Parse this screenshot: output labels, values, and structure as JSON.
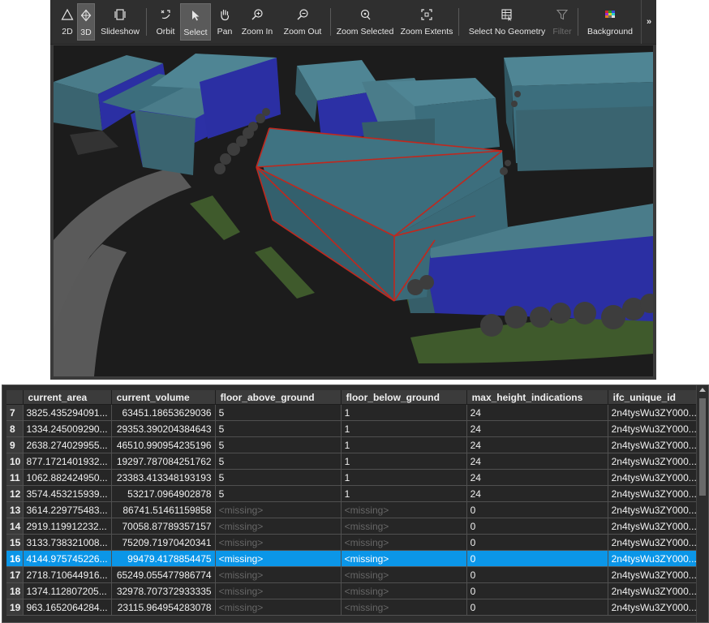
{
  "toolbar": {
    "items": [
      {
        "label": "2D",
        "icon": "triangle-icon"
      },
      {
        "label": "3D",
        "icon": "cube-3d-icon",
        "active": true
      },
      {
        "label": "Slideshow",
        "icon": "slideshow-icon"
      },
      {
        "label": "Orbit",
        "icon": "orbit-icon"
      },
      {
        "label": "Select",
        "icon": "cursor-icon",
        "active": true
      },
      {
        "label": "Pan",
        "icon": "hand-icon"
      },
      {
        "label": "Zoom In",
        "icon": "zoom-in-icon"
      },
      {
        "label": "Zoom Out",
        "icon": "zoom-out-icon"
      },
      {
        "label": "Zoom Selected",
        "icon": "zoom-selected-icon"
      },
      {
        "label": "Zoom Extents",
        "icon": "zoom-extents-icon"
      },
      {
        "label": "Select No Geometry",
        "icon": "select-no-geometry-icon"
      },
      {
        "label": "Filter",
        "icon": "filter-icon",
        "disabled": true
      },
      {
        "label": "Background",
        "icon": "background-palette-icon"
      }
    ],
    "overflow_label": "»"
  },
  "colors": {
    "selection_blue": "#0b96e8",
    "selection_outline": "#c0281e",
    "building_teal": "#3c6e7d",
    "building_blue": "#2b2fa3",
    "ground_green": "#3f5a2c"
  },
  "table": {
    "columns": [
      "current_area",
      "current_volume",
      "floor_above_ground",
      "floor_below_ground",
      "max_height_indications",
      "ifc_unique_id"
    ],
    "selected_row": 16,
    "rows": [
      {
        "idx": "7",
        "current_area": "3825.435294091...",
        "current_volume": "63451.18653629036",
        "floor_above_ground": "5",
        "floor_below_ground": "1",
        "max_height_indications": "24",
        "ifc_unique_id": "2n4tysWu3ZY000..."
      },
      {
        "idx": "8",
        "current_area": "1334.245009290...",
        "current_volume": "29353.390204384643",
        "floor_above_ground": "5",
        "floor_below_ground": "1",
        "max_height_indications": "24",
        "ifc_unique_id": "2n4tysWu3ZY000..."
      },
      {
        "idx": "9",
        "current_area": "2638.274029955...",
        "current_volume": "46510.990954235196",
        "floor_above_ground": "5",
        "floor_below_ground": "1",
        "max_height_indications": "24",
        "ifc_unique_id": "2n4tysWu3ZY000..."
      },
      {
        "idx": "10",
        "current_area": "877.1721401932...",
        "current_volume": "19297.787084251762",
        "floor_above_ground": "5",
        "floor_below_ground": "1",
        "max_height_indications": "24",
        "ifc_unique_id": "2n4tysWu3ZY000..."
      },
      {
        "idx": "11",
        "current_area": "1062.882424950...",
        "current_volume": "23383.413348193193",
        "floor_above_ground": "5",
        "floor_below_ground": "1",
        "max_height_indications": "24",
        "ifc_unique_id": "2n4tysWu3ZY000..."
      },
      {
        "idx": "12",
        "current_area": "3574.453215939...",
        "current_volume": "53217.0964902878",
        "floor_above_ground": "5",
        "floor_below_ground": "1",
        "max_height_indications": "24",
        "ifc_unique_id": "2n4tysWu3ZY000..."
      },
      {
        "idx": "13",
        "current_area": "3614.229775483...",
        "current_volume": "86741.51461159858",
        "floor_above_ground": "<missing>",
        "floor_below_ground": "<missing>",
        "max_height_indications": "0",
        "ifc_unique_id": "2n4tysWu3ZY000..."
      },
      {
        "idx": "14",
        "current_area": "2919.119912232...",
        "current_volume": "70058.87789357157",
        "floor_above_ground": "<missing>",
        "floor_below_ground": "<missing>",
        "max_height_indications": "0",
        "ifc_unique_id": "2n4tysWu3ZY000..."
      },
      {
        "idx": "15",
        "current_area": "3133.738321008...",
        "current_volume": "75209.71970420341",
        "floor_above_ground": "<missing>",
        "floor_below_ground": "<missing>",
        "max_height_indications": "0",
        "ifc_unique_id": "2n4tysWu3ZY000..."
      },
      {
        "idx": "16",
        "current_area": "4144.975745226...",
        "current_volume": "99479.4178854475",
        "floor_above_ground": "<missing>",
        "floor_below_ground": "<missing>",
        "max_height_indications": "0",
        "ifc_unique_id": "2n4tysWu3ZY000..."
      },
      {
        "idx": "17",
        "current_area": "2718.710644916...",
        "current_volume": "65249.055477986774",
        "floor_above_ground": "<missing>",
        "floor_below_ground": "<missing>",
        "max_height_indications": "0",
        "ifc_unique_id": "2n4tysWu3ZY000..."
      },
      {
        "idx": "18",
        "current_area": "1374.112807205...",
        "current_volume": "32978.707372933335",
        "floor_above_ground": "<missing>",
        "floor_below_ground": "<missing>",
        "max_height_indications": "0",
        "ifc_unique_id": "2n4tysWu3ZY000..."
      },
      {
        "idx": "19",
        "current_area": "963.1652064284...",
        "current_volume": "23115.964954283078",
        "floor_above_ground": "<missing>",
        "floor_below_ground": "<missing>",
        "max_height_indications": "0",
        "ifc_unique_id": "2n4tysWu3ZY000..."
      }
    ]
  }
}
